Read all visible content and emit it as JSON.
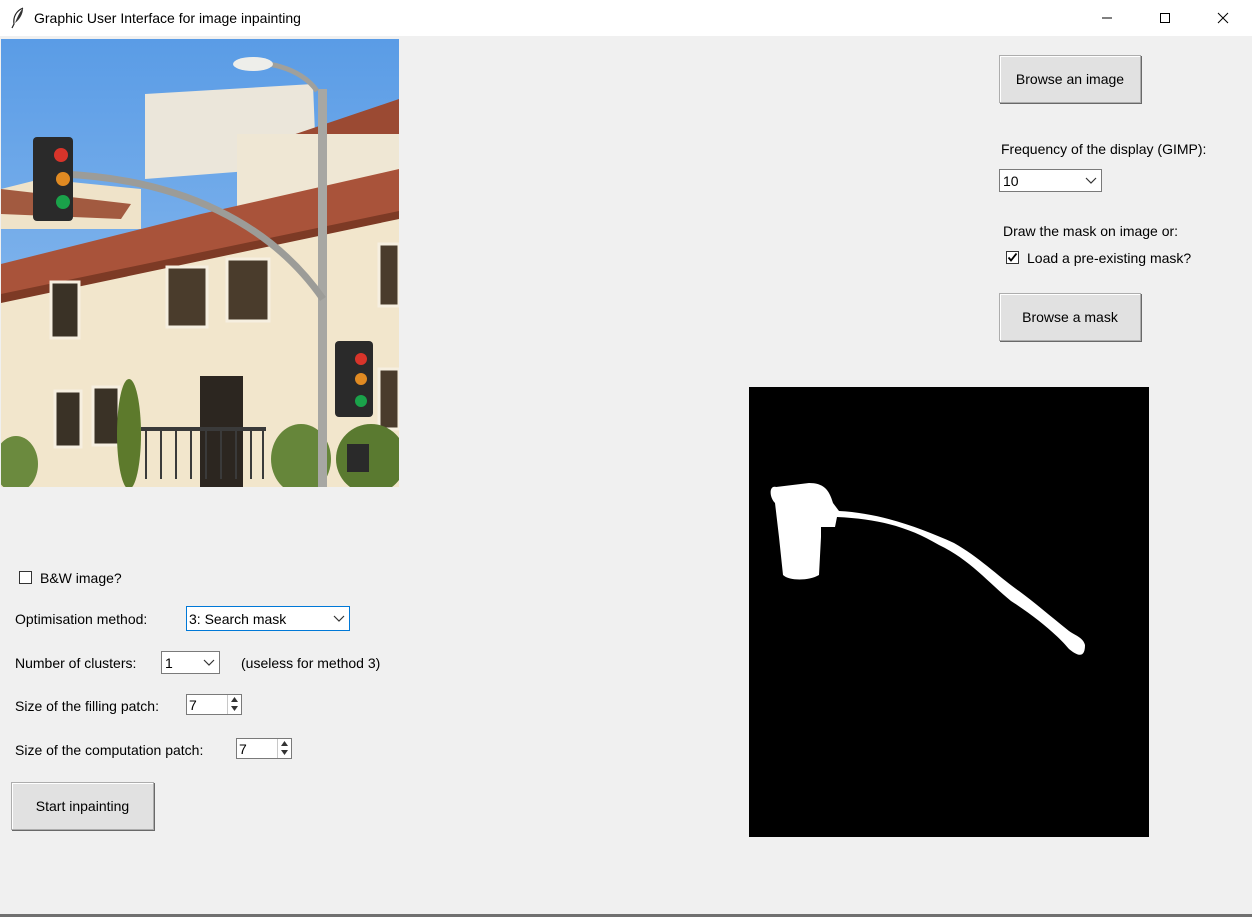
{
  "window": {
    "title": "Graphic User Interface for image inpainting",
    "controls": [
      "minimize",
      "maximize",
      "close"
    ]
  },
  "right_panel": {
    "browse_image_label": "Browse an image",
    "display_frequency_label": "Frequency of the display (GIMP):",
    "display_frequency_value": "10",
    "draw_mask_label": "Draw the mask on image or:",
    "load_mask_label": "Load a pre-existing mask?",
    "load_mask_checked": true,
    "browse_mask_label": "Browse a mask"
  },
  "left_panel": {
    "bw_label": "B&W image?",
    "bw_checked": false,
    "optimisation_label": "Optimisation method:",
    "optimisation_value": "3: Search mask",
    "clusters_label": "Number of clusters:",
    "clusters_value": "1",
    "clusters_note": "(useless for method 3)",
    "filling_patch_label": "Size of the filling patch:",
    "filling_patch_value": "7",
    "computation_patch_label": "Size of the computation patch:",
    "computation_patch_value": "7",
    "start_label": "Start inpainting"
  },
  "icons": {
    "app": "feather-icon",
    "minimize": "minimize-icon",
    "maximize": "maximize-icon",
    "close": "close-icon",
    "dropdown": "chevron-down-icon",
    "checkmark": "checkmark-icon"
  },
  "colors": {
    "window_bg": "#f0f0f0",
    "button_bg": "#e1e1e1",
    "focus_border": "#0078d7",
    "mask_bg": "#000000",
    "mask_fg": "#ffffff"
  }
}
